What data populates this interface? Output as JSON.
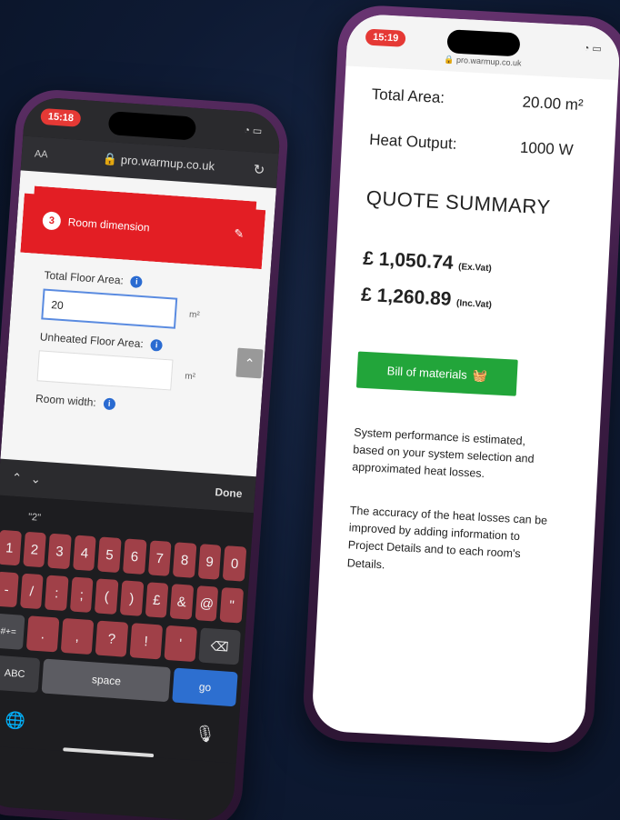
{
  "left_phone": {
    "status_time": "15:18",
    "url_bar": {
      "text_size_label": "AA",
      "url": "pro.warmup.co.uk"
    },
    "step": {
      "number": "3",
      "title": "Room dimension"
    },
    "form": {
      "total_floor_area": {
        "label": "Total Floor Area:",
        "value": "20",
        "unit": "m²"
      },
      "unheated_floor_area": {
        "label": "Unheated Floor Area:",
        "value": "",
        "unit": "m²"
      },
      "room_width": {
        "label": "Room width:"
      }
    },
    "keyboard": {
      "done_label": "Done",
      "suggestion": "\"2\"",
      "row1": [
        "1",
        "2",
        "3",
        "4",
        "5",
        "6",
        "7",
        "8",
        "9",
        "0"
      ],
      "row2": [
        "-",
        "/",
        ":",
        ";",
        "(",
        ")",
        "£",
        "&",
        "@",
        "\""
      ],
      "row3_switch": "#+=",
      "row3": [
        ".",
        ",",
        "?",
        "!",
        "'"
      ],
      "abc_label": "ABC",
      "space_label": "space",
      "go_label": "go"
    }
  },
  "right_phone": {
    "status_time": "15:19",
    "url": "pro.warmup.co.uk",
    "total_area": {
      "label": "Total Area:",
      "value": "20.00 m²"
    },
    "heat_output": {
      "label": "Heat Output:",
      "value": "1000 W"
    },
    "quote_title": "QUOTE SUMMARY",
    "price_ex_vat": {
      "amount": "£ 1,050.74",
      "suffix": "(Ex.Vat)"
    },
    "price_inc_vat": {
      "amount": "£ 1,260.89",
      "suffix": "(Inc.Vat)"
    },
    "bill_button_label": "Bill of materials",
    "paragraph1": "System performance is estimated, based on your system selection and approximated heat losses.",
    "paragraph2": "The accuracy of the heat losses can be improved by adding information to Project Details and to each room's Details."
  },
  "colors": {
    "brand_red": "#e31e24",
    "button_green": "#22a53a",
    "info_blue": "#2a6bd1",
    "background_navy": "#0e1a33"
  }
}
